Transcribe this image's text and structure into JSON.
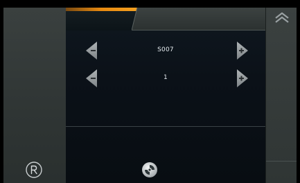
{
  "params": {
    "row1": {
      "value": "S007"
    },
    "row2": {
      "value": "1"
    }
  },
  "icons": {
    "left": "left-arrow-icon",
    "right": "right-arrow-icon",
    "registered": "registered-icon",
    "home": "home-icon",
    "up": "up-chevron-icon"
  },
  "colors": {
    "accent": "#f3a020",
    "panel": "#2f3534",
    "background": "#0b1118"
  }
}
